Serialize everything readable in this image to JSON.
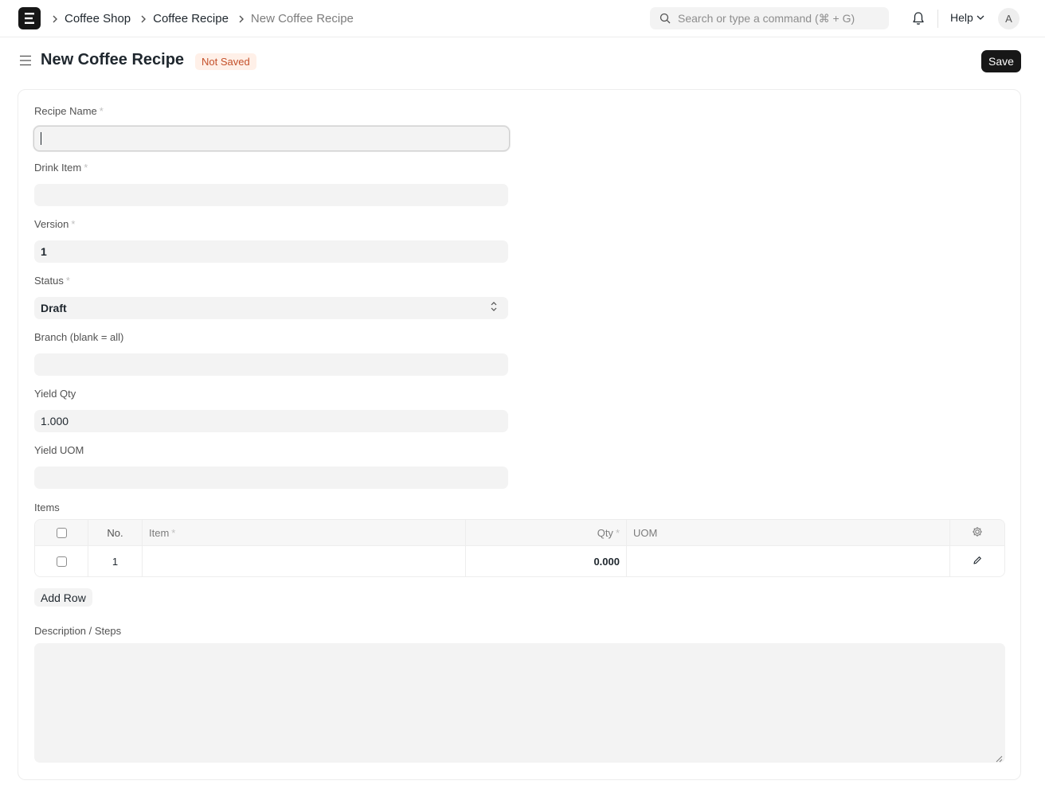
{
  "navbar": {
    "breadcrumbs": [
      "Coffee Shop",
      "Coffee Recipe",
      "New Coffee Recipe"
    ],
    "search_placeholder": "Search or type a command (⌘ + G)",
    "help_label": "Help",
    "avatar_initial": "A"
  },
  "header": {
    "title": "New Coffee Recipe",
    "status": "Not Saved",
    "save_label": "Save"
  },
  "form": {
    "recipe_name": {
      "label": "Recipe Name",
      "required": "*",
      "value": ""
    },
    "drink_item": {
      "label": "Drink Item",
      "required": "*",
      "value": ""
    },
    "version": {
      "label": "Version",
      "required": "*",
      "value": "1"
    },
    "status": {
      "label": "Status",
      "required": "*",
      "value": "Draft"
    },
    "branch": {
      "label": "Branch (blank = all)",
      "value": ""
    },
    "yield_qty": {
      "label": "Yield Qty",
      "value": "1.000"
    },
    "yield_uom": {
      "label": "Yield UOM",
      "value": ""
    }
  },
  "items": {
    "label": "Items",
    "columns": {
      "no": "No.",
      "item": "Item",
      "item_req": "*",
      "qty": "Qty",
      "qty_req": "*",
      "uom": "UOM"
    },
    "rows": [
      {
        "no": "1",
        "item": "",
        "qty": "0.000",
        "uom": ""
      }
    ],
    "add_row_label": "Add Row"
  },
  "description": {
    "label": "Description / Steps",
    "value": ""
  },
  "icons": [
    "search-icon",
    "bell-icon",
    "chevron-down-icon",
    "sidebar-toggle-icon",
    "gear-icon",
    "edit-icon",
    "chevron-right-icon",
    "resize-handle-icon"
  ]
}
